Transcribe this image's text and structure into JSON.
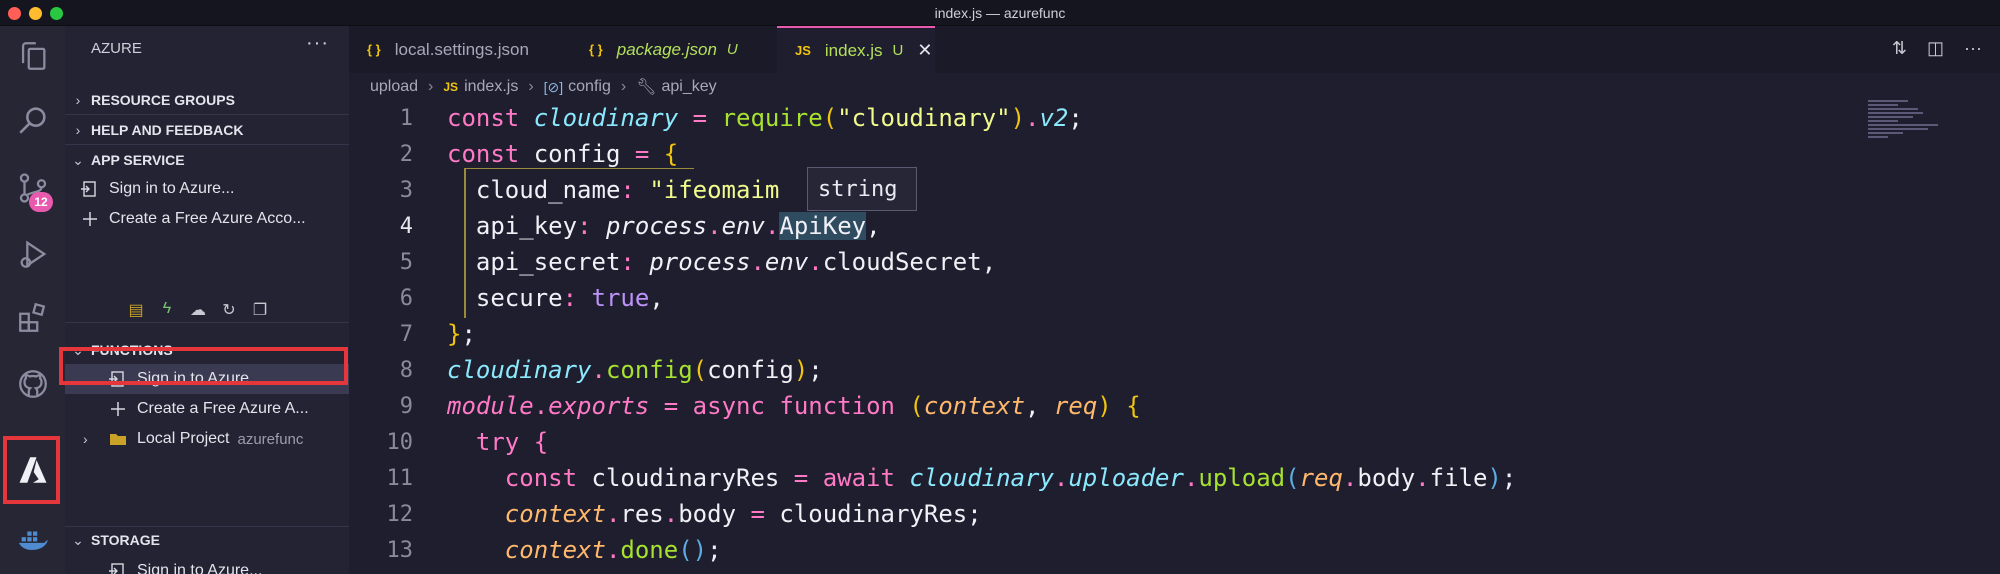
{
  "window": {
    "title": "index.js — azurefunc"
  },
  "activity": {
    "scm_badge": "12"
  },
  "sidebar": {
    "header": "AZURE",
    "more": "···",
    "sections": {
      "resource_groups": "RESOURCE GROUPS",
      "help": "HELP AND FEEDBACK",
      "app_service": "APP SERVICE",
      "functions": "FUNCTIONS",
      "storage": "STORAGE"
    },
    "app_service_items": [
      "Sign in to Azure...",
      "Create a Free Azure Acco..."
    ],
    "functions_items": [
      "Sign in to Azure...",
      "Create a Free Azure A...",
      "Local Project"
    ],
    "local_project_desc": "azurefunc",
    "storage_items": [
      "Sign in to Azure..."
    ]
  },
  "tabs": [
    {
      "icon": "{ }",
      "label": "local.settings.json",
      "status": ""
    },
    {
      "icon": "{ }",
      "label": "package.json",
      "status": "U"
    },
    {
      "icon": "JS",
      "label": "index.js",
      "status": "U"
    }
  ],
  "breadcrumb": [
    "upload",
    "index.js",
    "config",
    "api_key"
  ],
  "tooltip": "string",
  "code_lines": {
    "numbers": [
      "1",
      "2",
      "3",
      "4",
      "5",
      "6",
      "7",
      "8",
      "9",
      "10",
      "11",
      "12",
      "13"
    ],
    "l1": [
      "const",
      "cloudinary",
      "=",
      "require",
      "(",
      "\"cloudinary\"",
      ")",
      ".",
      "v2",
      ";"
    ],
    "l2": [
      "const",
      "config",
      "=",
      "{"
    ],
    "l3": [
      "cloud_name",
      ": ",
      "\"ifeomaim"
    ],
    "l4": [
      "api_key",
      ": ",
      "process",
      ".",
      "env",
      ".",
      "ApiKey",
      ","
    ],
    "l5": [
      "api_secret",
      ": ",
      "process",
      ".",
      "env",
      ".",
      "cloudSecret",
      ","
    ],
    "l6": [
      "secure",
      ": ",
      "true",
      ","
    ],
    "l7": [
      "}",
      ";"
    ],
    "l8": [
      "cloudinary",
      ".",
      "config",
      "(",
      "config",
      ")",
      ";"
    ],
    "l9": [
      "module",
      ".",
      "exports",
      " = ",
      "async",
      "function",
      "(",
      "context",
      ", ",
      "req",
      ")",
      "{"
    ],
    "l10": [
      "try",
      "{"
    ],
    "l11": [
      "const",
      "cloudinaryRes",
      " = ",
      "await",
      "cloudinary",
      ".",
      "uploader",
      ".",
      "upload",
      "(",
      "req",
      ".",
      "body",
      ".",
      "file",
      ")",
      ";"
    ],
    "l12": [
      "context",
      ".",
      "res",
      ".",
      "body",
      " = ",
      "cloudinaryRes",
      ";"
    ],
    "l13": [
      "context",
      ".",
      "done",
      "()",
      ";"
    ]
  }
}
